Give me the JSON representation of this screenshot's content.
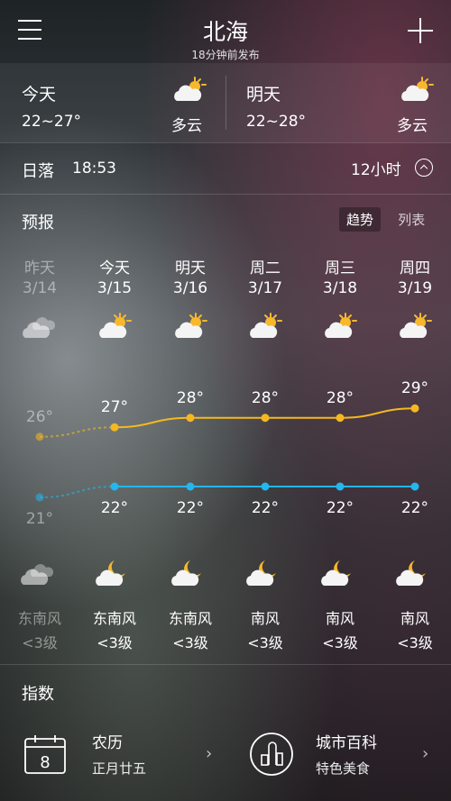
{
  "header": {
    "city": "北海",
    "published": "18分钟前发布"
  },
  "today": {
    "day": "今天",
    "temp": "22~27°",
    "condition": "多云",
    "icon": "partly-cloudy-day-icon"
  },
  "tomorrow": {
    "day": "明天",
    "temp": "22~28°",
    "condition": "多云",
    "icon": "partly-cloudy-day-icon"
  },
  "sunset": {
    "label": "日落",
    "time": "18:53"
  },
  "hours": {
    "label": "12小时"
  },
  "forecast": {
    "title": "预报",
    "tabs": [
      "趋势",
      "列表"
    ],
    "days": [
      {
        "day": "昨天",
        "date": "3/14",
        "high": 26,
        "low": 21,
        "high_label": "26°",
        "low_label": "21°",
        "wind": "东南风",
        "level": "<3级",
        "day_icon": "cloudy-icon",
        "night_icon": "cloudy-icon",
        "past": true
      },
      {
        "day": "今天",
        "date": "3/15",
        "high": 27,
        "low": 22,
        "high_label": "27°",
        "low_label": "22°",
        "wind": "东南风",
        "level": "<3级",
        "day_icon": "partly-cloudy-day-icon",
        "night_icon": "partly-cloudy-night-icon",
        "past": false
      },
      {
        "day": "明天",
        "date": "3/16",
        "high": 28,
        "low": 22,
        "high_label": "28°",
        "low_label": "22°",
        "wind": "东南风",
        "level": "<3级",
        "day_icon": "partly-cloudy-day-icon",
        "night_icon": "partly-cloudy-night-icon",
        "past": false
      },
      {
        "day": "周二",
        "date": "3/17",
        "high": 28,
        "low": 22,
        "high_label": "28°",
        "low_label": "22°",
        "wind": "南风",
        "level": "<3级",
        "day_icon": "partly-cloudy-day-icon",
        "night_icon": "partly-cloudy-night-icon",
        "past": false
      },
      {
        "day": "周三",
        "date": "3/18",
        "high": 28,
        "low": 22,
        "high_label": "28°",
        "low_label": "22°",
        "wind": "南风",
        "level": "<3级",
        "day_icon": "partly-cloudy-day-icon",
        "night_icon": "partly-cloudy-night-icon",
        "past": false
      },
      {
        "day": "周四",
        "date": "3/19",
        "high": 29,
        "low": 22,
        "high_label": "29°",
        "low_label": "22°",
        "wind": "南风",
        "level": "<3级",
        "day_icon": "partly-cloudy-day-icon",
        "night_icon": "partly-cloudy-night-icon",
        "past": false
      }
    ]
  },
  "indices": {
    "title": "指数",
    "items": [
      {
        "title": "农历",
        "subtitle": "正月廿五",
        "icon": "calendar-icon",
        "icon_text": "8"
      },
      {
        "title": "城市百科",
        "subtitle": "特色美食",
        "icon": "city-buildings-icon"
      }
    ]
  },
  "colors": {
    "high_line": "#f5b820",
    "low_line": "#23b6ef",
    "sun": "#f7b82b"
  }
}
